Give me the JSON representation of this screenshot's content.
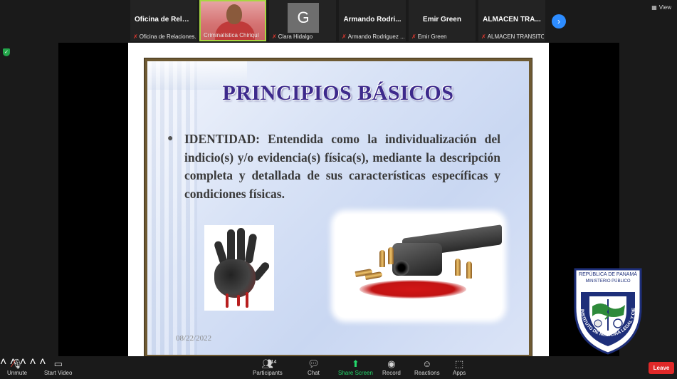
{
  "participants": [
    {
      "name": "Oficina de Relac...",
      "label": "Oficina de Relaciones...",
      "avatar": "",
      "active": false
    },
    {
      "name": "",
      "label": "Criminalística Chiriquí",
      "avatar": "",
      "active": true
    },
    {
      "name": "",
      "label": "Clara Hidalgo",
      "avatar": "G",
      "active": false
    },
    {
      "name": "Armando Rodri...",
      "label": "Armando Rodriguez ...",
      "avatar": "",
      "active": false
    },
    {
      "name": "Emir Green",
      "label": "Emir Green",
      "avatar": "",
      "active": false
    },
    {
      "name": "ALMACEN TRA...",
      "label": "ALMACEN TRANSITO...",
      "avatar": "",
      "active": false
    }
  ],
  "view_label": "View",
  "slide": {
    "title": "PRINCIPIOS BÁSICOS",
    "body": "IDENTIDAD: Entendida como la individualización del indicio(s) y/o evidencia(s) física(s), mediante la descripción completa y detallada de sus características específicas y condiciones físicas.",
    "date": "08/22/2022"
  },
  "logo": {
    "top_text": "REPÚBLICA DE PANAMÁ",
    "sub_text": "MINISTERIO PÚBLICO",
    "ring_text": "INSTITUTO DE MEDICINA LEGAL Y CIENCIAS FORENSES"
  },
  "toolbar": {
    "unmute": "Unmute",
    "start_video": "Start Video",
    "participants": "Participants",
    "participants_count": "14",
    "chat": "Chat",
    "share_screen": "Share Screen",
    "record": "Record",
    "reactions": "Reactions",
    "apps": "Apps",
    "leave": "Leave"
  },
  "colors": {
    "accent_green": "#a7d641",
    "share_green": "#23d96b",
    "leave_red": "#e02828",
    "title_purple": "#3d2a8c",
    "next_blue": "#2d8cff"
  }
}
